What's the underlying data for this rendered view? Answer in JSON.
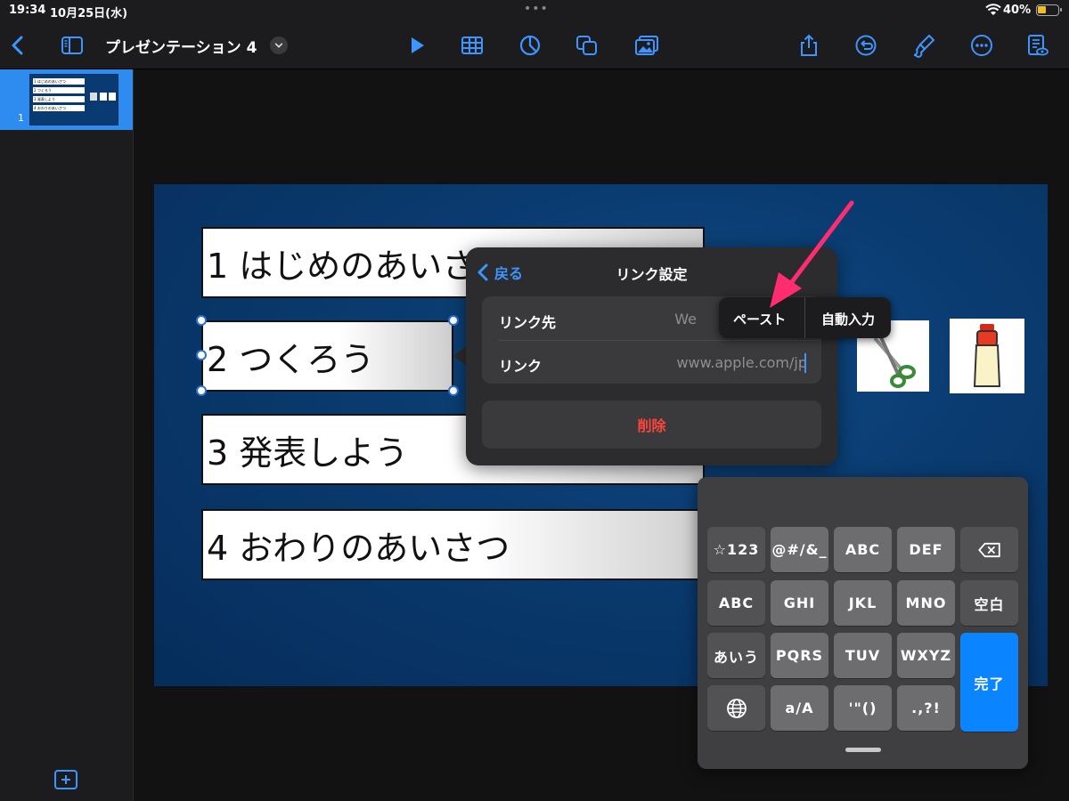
{
  "status": {
    "time": "19:34",
    "date": "10月25日(水)",
    "battery": "40%",
    "battery_level": 0.4
  },
  "toolbar": {
    "title": "プレゼンテーション 4",
    "icons": [
      "back-icon",
      "sidebar-icon",
      "chevron-down-icon",
      "play-icon",
      "table-icon",
      "chart-icon",
      "shape-icon",
      "media-icon",
      "share-icon",
      "undo-icon",
      "format-brush-icon",
      "more-icon",
      "presenter-notes-icon"
    ]
  },
  "sidebar": {
    "slides": [
      {
        "number": "1",
        "items": [
          "1 はじめのあいさつ",
          "2 つくろう",
          "3 発表しよう",
          "4 おわりのあいさつ"
        ]
      }
    ]
  },
  "slide": {
    "items": [
      "1 はじめのあいさつ",
      "2 つくろう",
      "3 発表しよう",
      "4 おわりのあいさつ"
    ],
    "images": [
      "scissors-image",
      "glue-image"
    ]
  },
  "popover": {
    "back": "戻る",
    "title": "リンク設定",
    "link_to_label": "リンク先",
    "link_to_value": "We",
    "link_label": "リンク",
    "link_placeholder": "www.apple.com/jp",
    "delete": "削除"
  },
  "edit_menu": {
    "paste": "ペースト",
    "autofill": "自動入力"
  },
  "keyboard": {
    "rows": [
      [
        "☆123",
        "@#/&_",
        "ABC",
        "DEF",
        "⌫"
      ],
      [
        "ABC",
        "GHI",
        "JKL",
        "MNO",
        "空白"
      ],
      [
        "あいう",
        "PQRS",
        "TUV",
        "WXYZ"
      ],
      [
        "🌐",
        "a/A",
        "'\"()",
        ".,?!"
      ]
    ],
    "done": "完了"
  },
  "colors": {
    "accent": "#0a84ff",
    "slide_background": "#0a3b70",
    "destructive": "#ff453a",
    "annotation_arrow": "#ff2d6f"
  }
}
